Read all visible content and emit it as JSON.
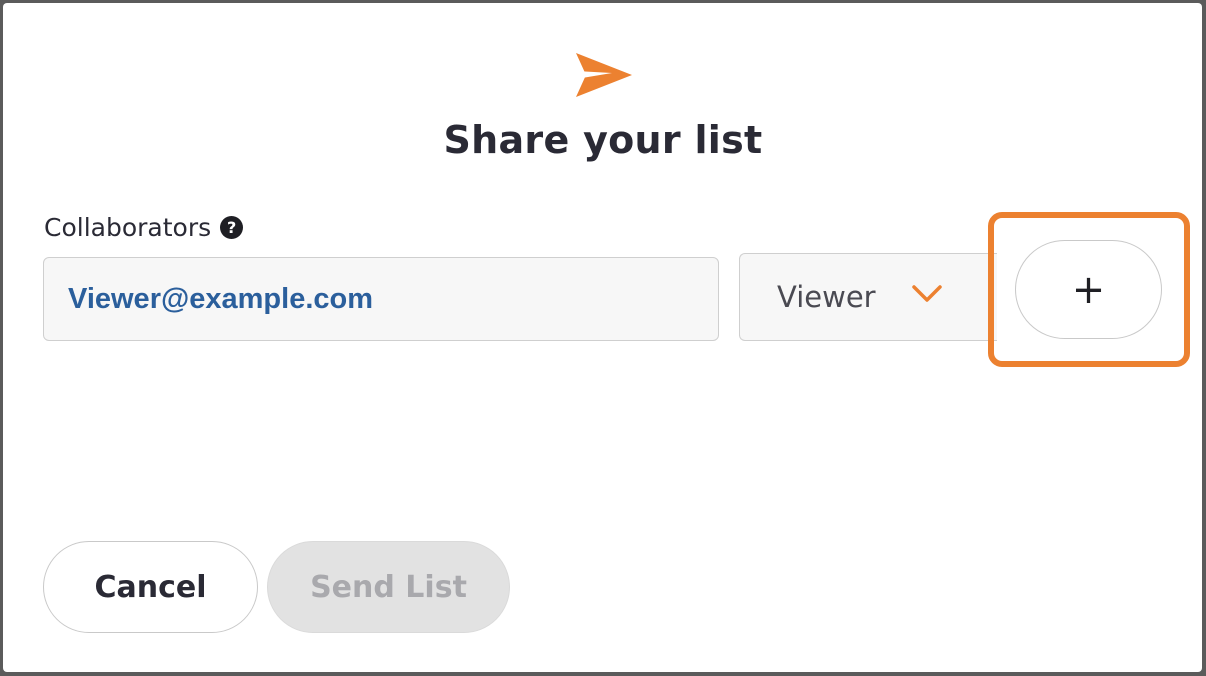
{
  "dialog": {
    "title": "Share your list",
    "icon": "send-icon"
  },
  "collaborators": {
    "label": "Collaborators",
    "help_icon_glyph": "?",
    "email_value": "Viewer@example.com",
    "role_value": "Viewer",
    "add_label": "+"
  },
  "actions": {
    "cancel_label": "Cancel",
    "send_label": "Send List"
  },
  "colors": {
    "accent": "#ec8130",
    "email_text": "#2b5f9c",
    "disabled_text": "#a9a9ad"
  }
}
